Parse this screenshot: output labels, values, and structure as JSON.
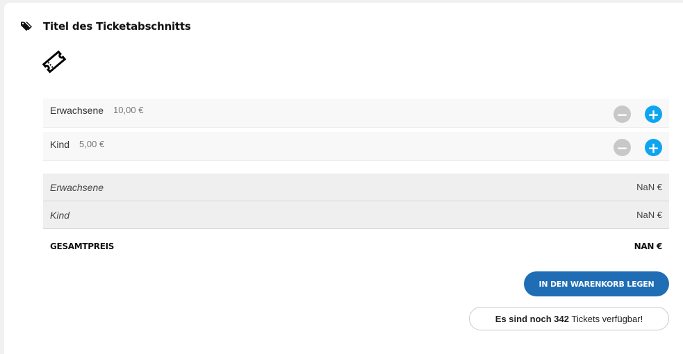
{
  "section": {
    "title": "Titel des Ticketabschnitts",
    "icon": "tag-icon",
    "ticket_icon": "ticket-icon"
  },
  "tickets": [
    {
      "name": "Erwachsene",
      "price": "10,00 €",
      "minus": "−",
      "plus": "+"
    },
    {
      "name": "Kind",
      "price": "5,00 €",
      "minus": "−",
      "plus": "+"
    }
  ],
  "summary": [
    {
      "name": "Erwachsene",
      "value": "NaN €"
    },
    {
      "name": "Kind",
      "value": "NaN €"
    }
  ],
  "total": {
    "label": "GESAMTPREIS",
    "value": "NAN €"
  },
  "cart_button": "IN DEN WARENKORB LEGEN",
  "availability": {
    "prefix": "Es sind noch ",
    "count": "342",
    "suffix": " Tickets verfügbar!"
  },
  "colors": {
    "plus": "#0ea5f0",
    "minus": "#c8c8c8",
    "cart_button": "#1f6db5"
  }
}
